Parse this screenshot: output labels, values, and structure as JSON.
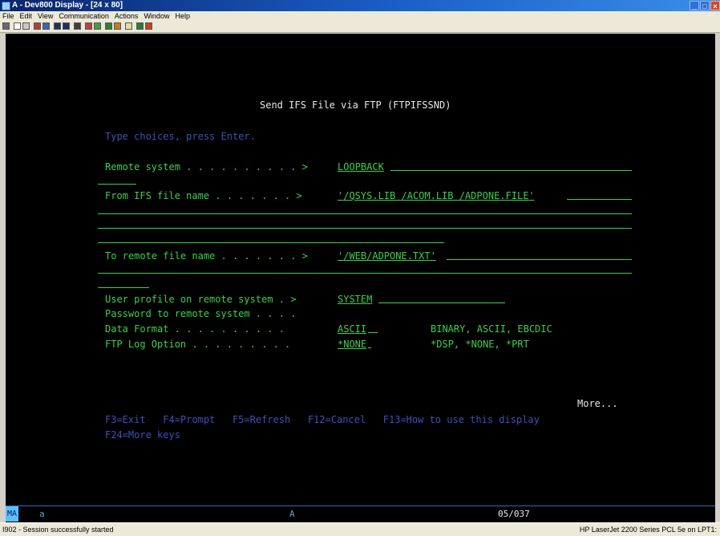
{
  "window": {
    "title": "A - Dev800 Display - [24 x 80]"
  },
  "menu": [
    "File",
    "Edit",
    "View",
    "Communication",
    "Actions",
    "Window",
    "Help"
  ],
  "toolbar_icons": [
    "print-screen-icon",
    "copy-icon",
    "paste-icon",
    "send-icon",
    "receive-icon",
    "display-icon",
    "display-alt-icon",
    "record-icon",
    "macro-icon",
    "macro-play-icon",
    "customize-icon",
    "keypad-icon",
    "map-icon",
    "color-icon",
    "support-icon"
  ],
  "screen": {
    "title": "Send IFS File via FTP (FTPIFSSND)",
    "instruction": "Type choices, press Enter.",
    "remote_system": {
      "label": "Remote system . . . . . . . . . . >",
      "value": "LOOPBACK"
    },
    "from_ifs": {
      "label": "From IFS file name . . . . . . . >",
      "value": "'/QSYS.LIB /ACOM.LIB /ADPONE.FILE'"
    },
    "to_remote": {
      "label": "To remote file name . . . . . . . >",
      "value": "'/WEB/ADPONE.TXT'"
    },
    "user_profile": {
      "label": "User profile on remote system . >",
      "value": "SYSTEM"
    },
    "password": {
      "label": "Password to remote system . . . ."
    },
    "data_format": {
      "label": "Data Format . . . . . . . . . .",
      "value": "ASCII",
      "choices": "BINARY, ASCII, EBCDIC"
    },
    "ftp_log": {
      "label": "FTP Log Option . . . . . . . . .",
      "value": "*NONE",
      "choices": "*DSP, *NONE, *PRT"
    },
    "more": "More...",
    "function_keys_1": "F3=Exit   F4=Prompt   F5=Refresh   F12=Cancel   F13=How to use this display",
    "function_keys_2": "F24=More keys"
  },
  "oia": {
    "indicator": "MA",
    "session": "a",
    "mode": "A",
    "cursor": "05/037"
  },
  "status": {
    "left": "I902 - Session successfully started",
    "right": "HP LaserJet 2200 Series PCL 5e on LPT1:"
  }
}
